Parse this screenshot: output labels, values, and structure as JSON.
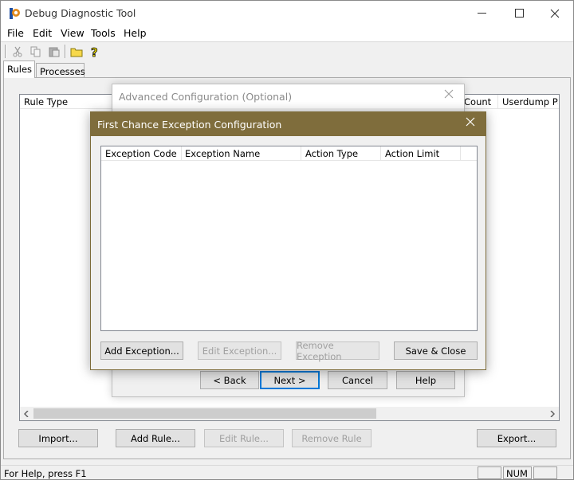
{
  "window": {
    "title": "Debug Diagnostic Tool"
  },
  "menu": {
    "items": [
      "File",
      "Edit",
      "View",
      "Tools",
      "Help"
    ]
  },
  "tabs": {
    "rules": "Rules",
    "processes": "Processes"
  },
  "main_list": {
    "columns": [
      "Rule Type",
      "Count",
      "Userdump Pat"
    ]
  },
  "main_buttons": {
    "import": "Import...",
    "add_rule": "Add Rule...",
    "edit_rule": "Edit Rule...",
    "remove_rule": "Remove Rule",
    "export": "Export..."
  },
  "status": {
    "text": "For Help, press F1",
    "num": "NUM"
  },
  "advanced_dialog": {
    "title": "Advanced Configuration (Optional)",
    "back": "< Back",
    "next": "Next >",
    "cancel": "Cancel",
    "help": "Help"
  },
  "fc_dialog": {
    "title": "First Chance Exception Configuration",
    "columns": [
      "Exception Code",
      "Exception Name",
      "Action Type",
      "Action Limit"
    ],
    "add_exception": "Add Exception...",
    "edit_exception": "Edit Exception...",
    "remove_exception": "Remove Exception",
    "save_close": "Save & Close"
  },
  "colors": {
    "dialog_title_bg": "#7f6d3c",
    "accent": "#0078d7"
  }
}
